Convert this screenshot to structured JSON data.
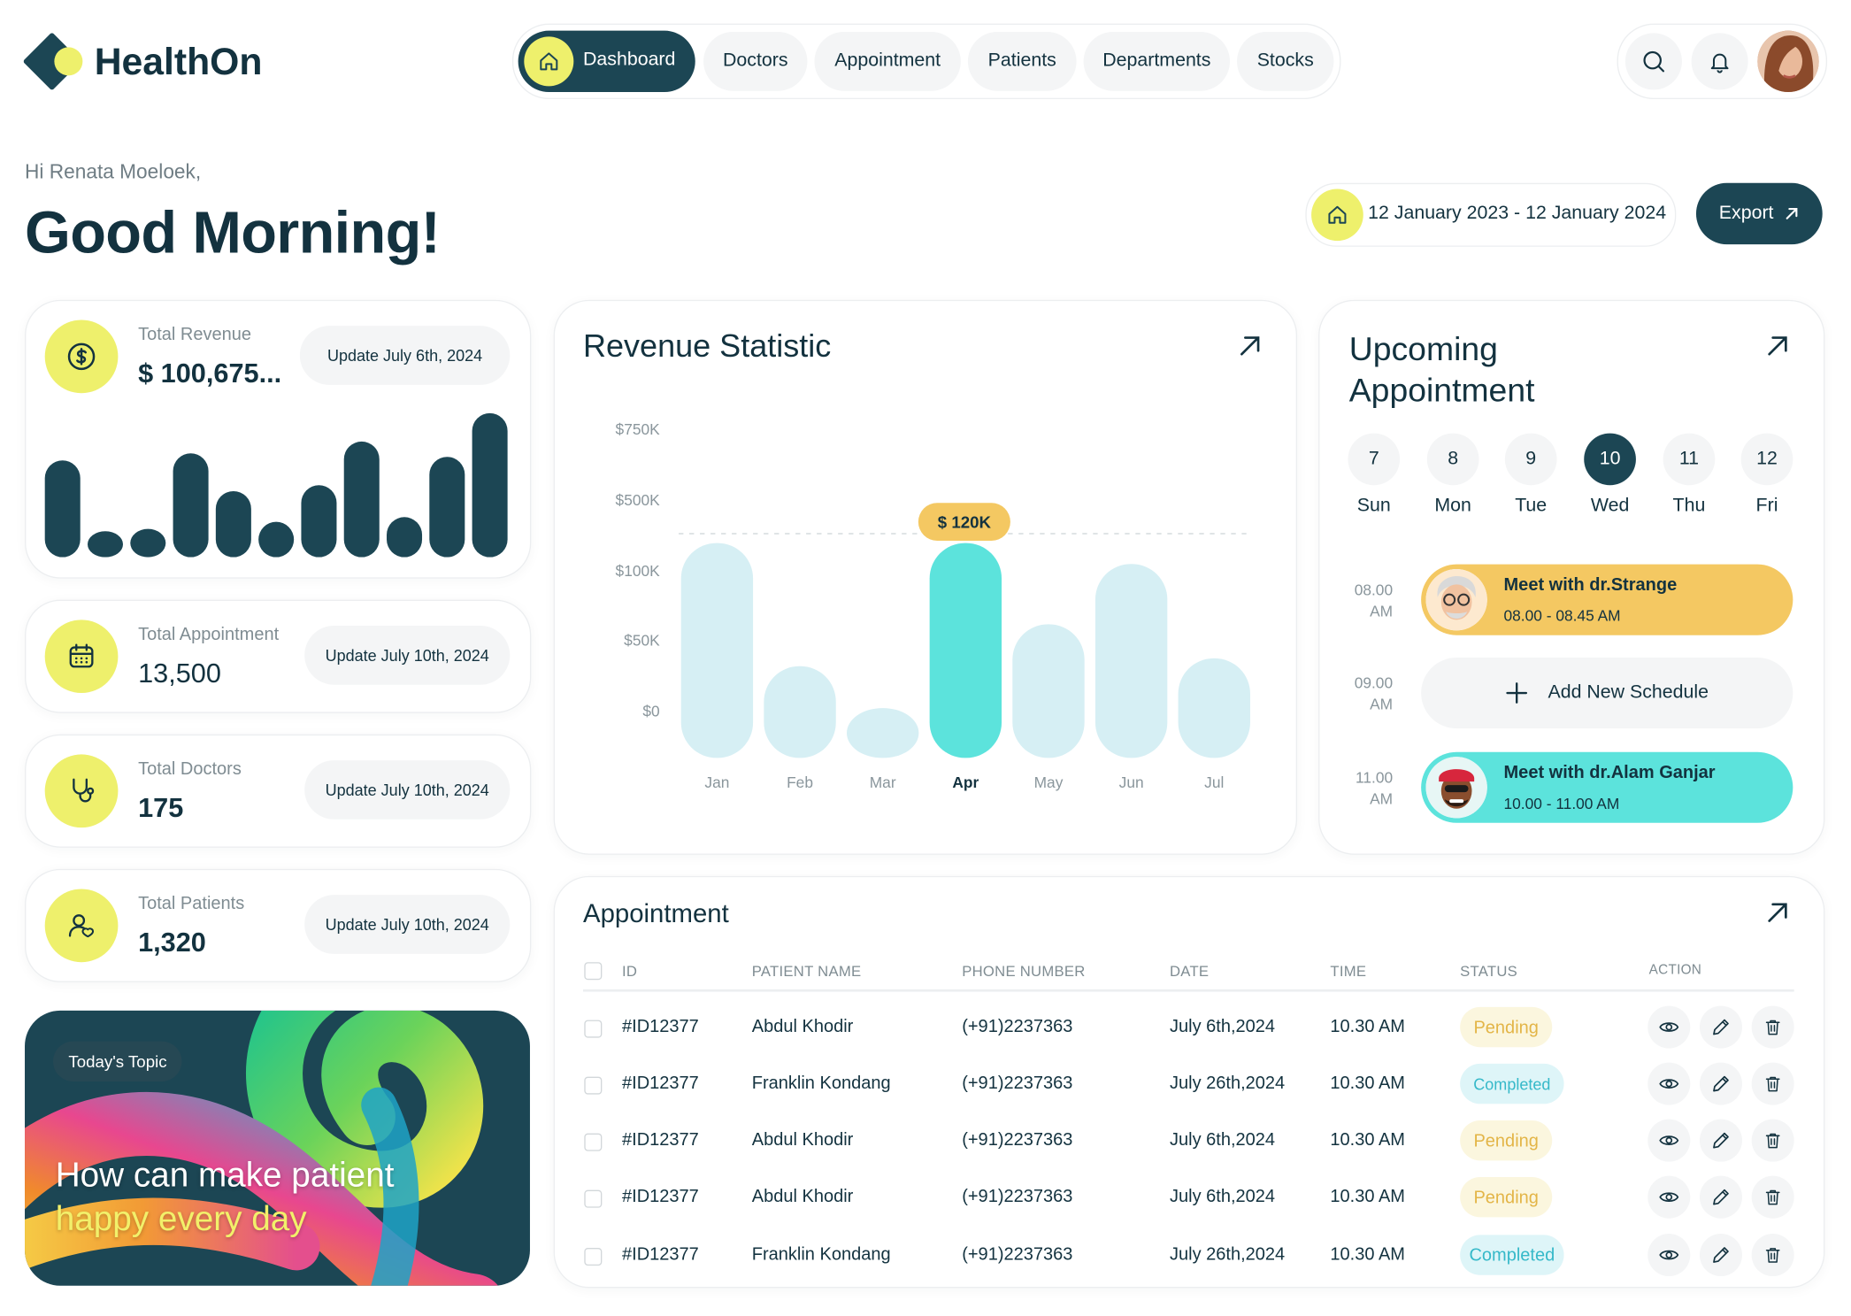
{
  "brand": {
    "name": "HealthOn"
  },
  "nav": [
    "Dashboard",
    "Doctors",
    "Appointment",
    "Patients",
    "Departments",
    "Stocks"
  ],
  "greeting": {
    "hi": "Hi Renata Moeloek,",
    "title": "Good Morning!"
  },
  "date_range": "12 January 2023 - 12 January 2024",
  "export_label": "Export",
  "stats": [
    {
      "label": "Total Revenue",
      "value": "$ 100,675...",
      "update": "Update July 6th, 2024",
      "icon": "dollar-icon"
    },
    {
      "label": "Total Appointment",
      "value": "13,500",
      "update": "Update July 10th, 2024",
      "icon": "calendar-icon"
    },
    {
      "label": "Total Doctors",
      "value": "175",
      "update": "Update July 10th, 2024",
      "icon": "stethoscope-icon"
    },
    {
      "label": "Total Patients",
      "value": "1,320",
      "update": "Update July 10th, 2024",
      "icon": "patients-icon"
    }
  ],
  "topic": {
    "tag": "Today's Topic",
    "line1": "How can make patient",
    "line2": "happy every day"
  },
  "revenue": {
    "title": "Revenue Statistic",
    "tooltip": "$ 120K"
  },
  "chart_data": {
    "type": "bar",
    "title": "Revenue Statistic",
    "categories": [
      "Jan",
      "Feb",
      "Mar",
      "Apr",
      "May",
      "Jun",
      "Jul"
    ],
    "y_tick_labels": [
      "$750K",
      "$500K",
      "$100K",
      "$50K",
      "$0"
    ],
    "values_relative_height": [
      0.82,
      0.35,
      0.19,
      0.82,
      0.51,
      0.74,
      0.38
    ],
    "highlight": "Apr",
    "highlight_label": "$ 120K",
    "colors": {
      "bar": "#d6eff4",
      "highlight": "#5ce3dc",
      "tooltip": "#f4c862"
    }
  },
  "upcoming": {
    "title_line1": "Upcoming",
    "title_line2": "Appointment",
    "days": [
      {
        "num": "7",
        "day": "Sun"
      },
      {
        "num": "8",
        "day": "Mon"
      },
      {
        "num": "9",
        "day": "Tue"
      },
      {
        "num": "10",
        "day": "Wed",
        "active": true
      },
      {
        "num": "11",
        "day": "Thu"
      },
      {
        "num": "12",
        "day": "Fri"
      }
    ],
    "slots": [
      {
        "time1": "08.00",
        "time2": "AM",
        "title": "Meet with dr.Strange",
        "range": "08.00 - 08.45 AM"
      },
      {
        "time1": "09.00",
        "time2": "AM",
        "title": "Add New Schedule"
      },
      {
        "time1": "11.00",
        "time2": "AM",
        "title": "Meet with dr.Alam Ganjar",
        "range": "10.00 - 11.00 AM"
      }
    ]
  },
  "appointment": {
    "title": "Appointment",
    "columns": [
      "ID",
      "PATIENT NAME",
      "PHONE NUMBER",
      "DATE",
      "TIME",
      "STATUS",
      "ACTION"
    ],
    "rows": [
      {
        "id": "#ID12377",
        "name": "Abdul Khodir",
        "phone": "(+91)2237363",
        "date": "July 6th,2024",
        "time": "10.30 AM",
        "status": "Pending"
      },
      {
        "id": "#ID12377",
        "name": "Franklin Kondang",
        "phone": "(+91)2237363",
        "date": "July 26th,2024",
        "time": "10.30 AM",
        "status": "Completed"
      },
      {
        "id": "#ID12377",
        "name": "Abdul Khodir",
        "phone": "(+91)2237363",
        "date": "July 6th,2024",
        "time": "10.30 AM",
        "status": "Pending"
      },
      {
        "id": "#ID12377",
        "name": "Abdul Khodir",
        "phone": "(+91)2237363",
        "date": "July 6th,2024",
        "time": "10.30 AM",
        "status": "Pending"
      },
      {
        "id": "#ID12377",
        "name": "Franklin Kondang",
        "phone": "(+91)2237363",
        "date": "July 26th,2024",
        "time": "10.30 AM",
        "status": "Completed"
      }
    ]
  },
  "colors": {
    "primary": "#1c4654",
    "accent_yellow": "#eef06c",
    "teal": "#5ce3dc",
    "pending_text": "#e3b547",
    "completed_text": "#36b9c9"
  }
}
